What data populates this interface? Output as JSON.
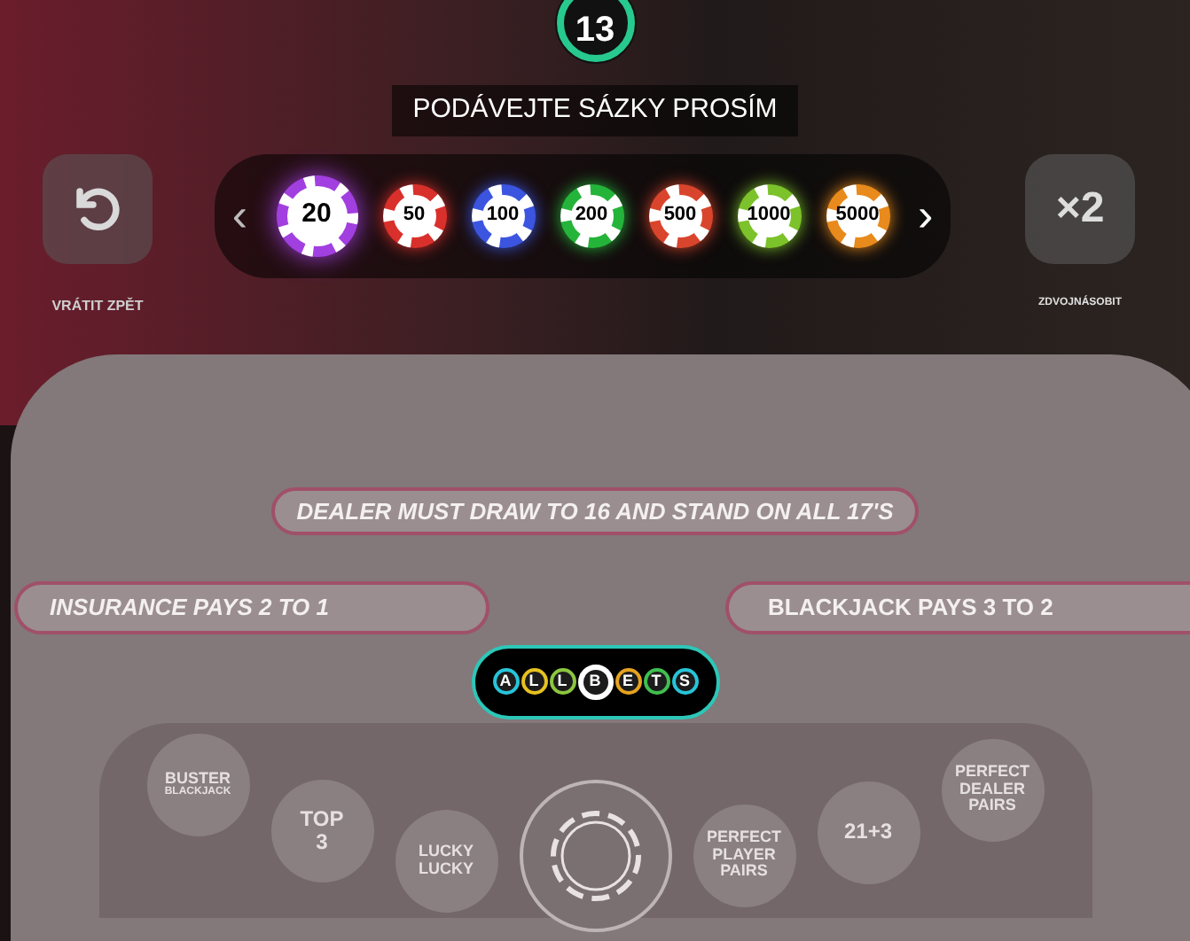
{
  "timer": {
    "text": "13"
  },
  "banner": "PODÁVEJTE SÁZKY PROSÍM",
  "undo": {
    "label": "VRÁTIT ZPĚT",
    "disabled": false
  },
  "double": {
    "text": "×2",
    "label": "ZDVOJNÁSOBIT"
  },
  "chips": [
    {
      "value": "20",
      "color": "#a23fe0",
      "selected": true
    },
    {
      "value": "50",
      "color": "#d9302c",
      "selected": false
    },
    {
      "value": "100",
      "color": "#3b55e0",
      "selected": false
    },
    {
      "value": "200",
      "color": "#25b43a",
      "selected": false
    },
    {
      "value": "500",
      "color": "#d9452c",
      "selected": false
    },
    {
      "value": "1000",
      "color": "#7cc22a",
      "selected": false
    },
    {
      "value": "5000",
      "color": "#e88a1c",
      "selected": false
    }
  ],
  "nav": {
    "prev": "‹",
    "next": "›"
  },
  "table": {
    "rule": "DEALER MUST DRAW TO 16 AND STAND ON ALL 17'S",
    "insurance": "INSURANCE PAYS 2 TO 1",
    "blackjack": "BLACKJACK PAYS 3 TO 2"
  },
  "all_bets": [
    {
      "text": "A",
      "color": "#27c4d9",
      "selected": false
    },
    {
      "text": "L",
      "color": "#e6c21f",
      "selected": false
    },
    {
      "text": "L",
      "color": "#8cc63f",
      "selected": false
    },
    {
      "text": "B",
      "color": "#ffffff",
      "selected": true
    },
    {
      "text": "E",
      "color": "#e6a21f",
      "selected": false
    },
    {
      "text": "T",
      "color": "#3fbf4f",
      "selected": false
    },
    {
      "text": "S",
      "color": "#27c4d9",
      "selected": false
    }
  ],
  "side_bets": [
    {
      "lines": [
        "BUSTER",
        "BLACKJACK"
      ]
    },
    {
      "lines": [
        "TOP",
        "3"
      ]
    },
    {
      "lines": [
        "LUCKY",
        "LUCKY"
      ]
    },
    {
      "kind": "main"
    },
    {
      "lines": [
        "PERFECT",
        "PLAYER",
        "PAIRS"
      ]
    },
    {
      "lines": [
        "21+3"
      ]
    },
    {
      "lines": [
        "PERFECT",
        "DEALER",
        "PAIRS"
      ]
    }
  ]
}
